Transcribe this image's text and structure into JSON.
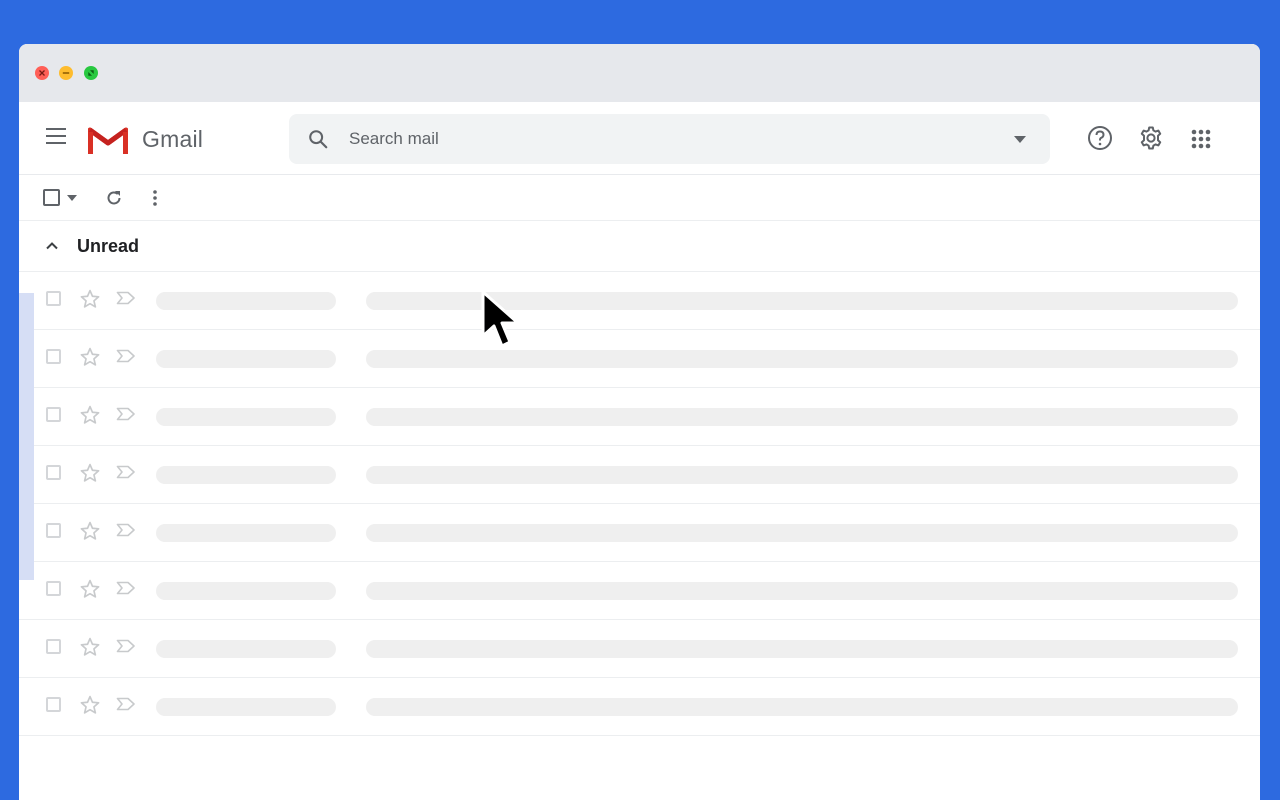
{
  "window": {
    "controls": [
      "close",
      "minimize",
      "maximize"
    ]
  },
  "header": {
    "brand": "Gmail",
    "search": {
      "placeholder": "Search mail"
    },
    "icons": [
      "help-icon",
      "settings-icon",
      "apps-icon"
    ]
  },
  "toolbar": {
    "icons": [
      "select-checkbox",
      "select-dropdown-icon",
      "refresh-icon",
      "more-icon"
    ]
  },
  "section": {
    "title": "Unread",
    "expanded": true
  },
  "rows": [
    {
      "state": "loading"
    },
    {
      "state": "loading"
    },
    {
      "state": "loading"
    },
    {
      "state": "loading"
    },
    {
      "state": "loading"
    },
    {
      "state": "loading"
    },
    {
      "state": "loading"
    },
    {
      "state": "loading"
    }
  ],
  "colors": {
    "background": "#2d6ae0",
    "titlebar": "#e6e8ec",
    "search_bg": "#f1f3f4",
    "skeleton": "#efefef",
    "logo_red": "#d93025"
  }
}
